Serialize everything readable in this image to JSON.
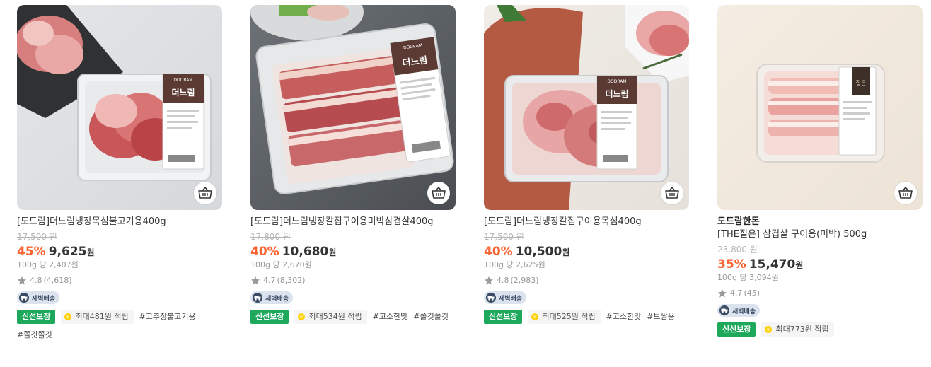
{
  "colors": {
    "discount": "#fa622f",
    "fresh": "#1ea85c",
    "delivery_bg": "#dbe3ef"
  },
  "products": [
    {
      "name": "[도드람]더느림냉장목심불고기용400g",
      "original_price": "17,500 원",
      "discount": "45%",
      "price": "9,625",
      "currency": "원",
      "unit_price": "100g 당 2,407원",
      "rating": "4.8",
      "review_count": "(4,618)",
      "delivery": "새벽배송",
      "fresh_badge": "신선보장",
      "points": "최대481원 적립",
      "hashtags": [
        "#고추장불고기용",
        "#쫄깃쫄깃"
      ]
    },
    {
      "name": "[도드람]더느림냉장칼집구이용미박삼겹살400g",
      "original_price": "17,800 원",
      "discount": "40%",
      "price": "10,680",
      "currency": "원",
      "unit_price": "100g 당 2,670원",
      "rating": "4.7",
      "review_count": "(8,302)",
      "delivery": "새벽배송",
      "fresh_badge": "신선보장",
      "points": "최대534원 적립",
      "hashtags": [
        "#고소한맛",
        "#쫄깃쫄깃"
      ]
    },
    {
      "name": "[도드람]더느림냉장칼집구이용목심400g",
      "original_price": "17,500 원",
      "discount": "40%",
      "price": "10,500",
      "currency": "원",
      "unit_price": "100g 당 2,625원",
      "rating": "4.8",
      "review_count": "(2,983)",
      "delivery": "새벽배송",
      "fresh_badge": "신선보장",
      "points": "최대525원 적립",
      "hashtags": [
        "#고소한맛",
        "#보쌈용"
      ]
    },
    {
      "brand": "도드람한돈",
      "name": "[THE질은] 삼겹살 구이용(미박) 500g",
      "original_price": "23,800 원",
      "discount": "35%",
      "price": "15,470",
      "currency": "원",
      "unit_price": "100g 당 3,094원",
      "rating": "4.7",
      "review_count": "(45)",
      "delivery": "새벽배송",
      "fresh_badge": "신선보장",
      "points": "최대773원 적립",
      "hashtags": []
    }
  ],
  "package_labels": {
    "logo": "DODRAM",
    "product_line": "더느림",
    "premium_line": "질은"
  },
  "icons": {
    "cart": "cart-icon",
    "star": "star-icon",
    "truck": "truck-icon",
    "coin": "coin-icon"
  }
}
